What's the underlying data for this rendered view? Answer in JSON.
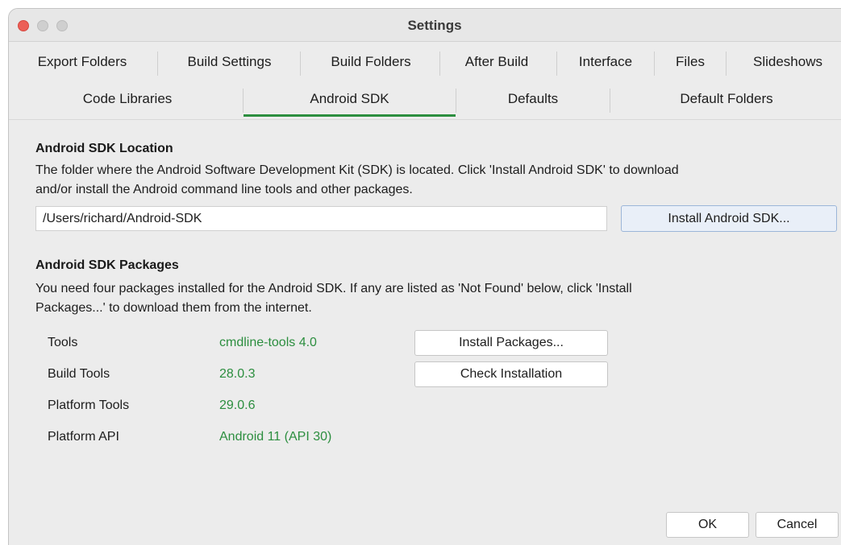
{
  "window": {
    "title": "Settings"
  },
  "tabs": {
    "row1": [
      "Export Folders",
      "Build Settings",
      "Build Folders",
      "After Build",
      "Interface",
      "Files",
      "Slideshows"
    ],
    "row2": [
      "Code Libraries",
      "Android SDK",
      "Defaults",
      "Default Folders"
    ],
    "active": "Android SDK"
  },
  "sdk_location": {
    "heading": "Android SDK Location",
    "description_line1": "The folder where the Android Software Development Kit (SDK) is located. Click 'Install Android SDK' to download",
    "description_line2": "and/or install the Android command line tools and other packages.",
    "path_value": "/Users/richard/Android-SDK",
    "install_button": "Install Android SDK..."
  },
  "sdk_packages": {
    "heading": "Android SDK Packages",
    "description_line1": "You need four packages installed for the Android SDK. If any are listed as 'Not Found' below, click 'Install",
    "description_line2": "Packages...' to download them from the internet.",
    "rows": [
      {
        "label": "Tools",
        "value": "cmdline-tools 4.0"
      },
      {
        "label": "Build Tools",
        "value": "28.0.3"
      },
      {
        "label": "Platform Tools",
        "value": "29.0.6"
      },
      {
        "label": "Platform API",
        "value": "Android 11 (API 30)"
      }
    ],
    "install_packages_button": "Install Packages...",
    "check_installation_button": "Check Installation"
  },
  "footer": {
    "ok_button": "OK",
    "cancel_button": "Cancel"
  },
  "colors": {
    "accent_green": "#2c8e3f",
    "close_red": "#ec5f57"
  }
}
